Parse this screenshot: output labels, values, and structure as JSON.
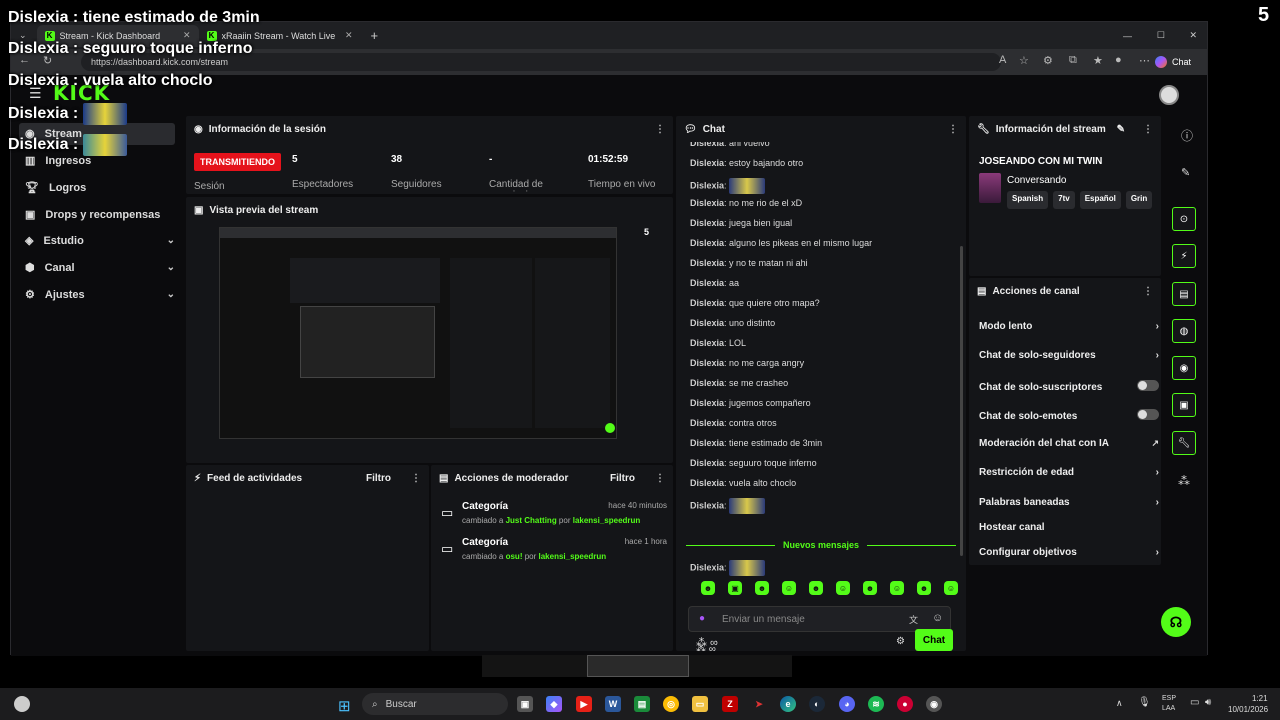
{
  "overlay": {
    "corner_number": "5",
    "lines": [
      {
        "name": "Dislexia",
        "sep": " : ",
        "text": "tiene estimado de 3min"
      },
      {
        "name": "Dislexia",
        "sep": " : ",
        "text": "seguuro toque inferno"
      },
      {
        "name": "Dislexia",
        "sep": " : ",
        "text": "vuela alto choclo"
      },
      {
        "name": "Dislexia",
        "sep": " : ",
        "text": ""
      },
      {
        "name": "Dislexia",
        "sep": " : ",
        "text": ""
      }
    ]
  },
  "browser": {
    "tabs": [
      {
        "label": "Stream - Kick Dashboard"
      },
      {
        "label": "xRaaiin Stream - Watch Live on Kic"
      }
    ],
    "url": "https://dashboard.kick.com/stream",
    "chat_button": "Chat"
  },
  "sidebar": {
    "logo": "KICK",
    "items": [
      {
        "label": "Stream"
      },
      {
        "label": "Ingresos"
      },
      {
        "label": "Logros"
      },
      {
        "label": "Drops y recompensas"
      },
      {
        "label": "Estudio"
      },
      {
        "label": "Canal"
      },
      {
        "label": "Ajustes"
      }
    ]
  },
  "session": {
    "title": "Información de la sesión",
    "badge": "TRANSMITIENDO",
    "badge_label": "Sesión",
    "stats": [
      {
        "value": "5",
        "label": "Espectadores"
      },
      {
        "value": "38",
        "label": "Seguidores"
      },
      {
        "value": "-",
        "label": "Cantidad de suscripciones"
      },
      {
        "value": "01:52:59",
        "label": "Tiempo en vivo"
      }
    ]
  },
  "preview": {
    "title": "Vista previa del stream",
    "overlay_number": "5"
  },
  "activity": {
    "title": "Feed de actividades",
    "filter": "Filtro"
  },
  "modactions": {
    "title": "Acciones de moderador",
    "filter": "Filtro",
    "items": [
      {
        "title": "Categoría",
        "time": "hace 40 minutos",
        "prefix": "cambiado a ",
        "category": "Just Chatting",
        "by": " por ",
        "user": "lakensi_speedrun"
      },
      {
        "title": "Categoría",
        "time": "hace 1 hora",
        "prefix": "cambiado a ",
        "category": "osu!",
        "by": " por ",
        "user": "lakensi_speedrun"
      }
    ]
  },
  "chat": {
    "title": "Chat",
    "messages": [
      {
        "user": "Dislexia",
        "text": "ahi vuelvo"
      },
      {
        "user": "Dislexia",
        "text": "estoy bajando otro"
      },
      {
        "user": "Dislexia",
        "text": ""
      },
      {
        "user": "Dislexia",
        "text": "no me rio de el xD"
      },
      {
        "user": "Dislexia",
        "text": "juega bien igual"
      },
      {
        "user": "Dislexia",
        "text": "alguno les pikeas en el mismo lugar"
      },
      {
        "user": "Dislexia",
        "text": "y no te matan ni ahi"
      },
      {
        "user": "Dislexia",
        "text": "aa"
      },
      {
        "user": "Dislexia",
        "text": "que quiere otro mapa?"
      },
      {
        "user": "Dislexia",
        "text": "uno distinto"
      },
      {
        "user": "Dislexia",
        "text": "LOL"
      },
      {
        "user": "Dislexia",
        "text": "no me carga angry"
      },
      {
        "user": "Dislexia",
        "text": "se me crasheo"
      },
      {
        "user": "Dislexia",
        "text": "jugemos compañero"
      },
      {
        "user": "Dislexia",
        "text": "contra otros"
      },
      {
        "user": "Dislexia",
        "text": "tiene estimado de 3min"
      },
      {
        "user": "Dislexia",
        "text": "seguuro toque inferno"
      },
      {
        "user": "Dislexia",
        "text": "vuela alto choclo"
      },
      {
        "user": "Dislexia",
        "text": ""
      }
    ],
    "new_messages": "Nuevos mensajes",
    "last_message": {
      "user": "Dislexia",
      "text": ""
    },
    "input_placeholder": "Enviar un mensaje",
    "send_button": "Chat"
  },
  "stream_info": {
    "title": "Información del stream",
    "stream_title": "JOSEANDO CON MI TWIN",
    "category": "Conversando",
    "tags": [
      "Spanish",
      "7tv",
      "Español",
      "Grin"
    ]
  },
  "channel_actions": {
    "title": "Acciones de canal",
    "items": [
      {
        "label": "Modo lento",
        "control": "chevron"
      },
      {
        "label": "Chat de solo-seguidores",
        "control": "chevron"
      },
      {
        "label": "Chat de solo-suscriptores",
        "control": "toggle"
      },
      {
        "label": "Chat de solo-emotes",
        "control": "toggle"
      },
      {
        "label": "Moderación del chat con IA",
        "control": "external"
      },
      {
        "label": "Restricción de edad",
        "control": "chevron"
      },
      {
        "label": "Palabras baneadas",
        "control": "chevron"
      },
      {
        "label": "Hostear canal",
        "control": "none"
      },
      {
        "label": "Configurar objetivos",
        "control": "chevron"
      }
    ]
  },
  "taskbar": {
    "search_placeholder": "Buscar",
    "lang": "ESP",
    "lang2": "LAA",
    "time": "1:21",
    "date": "10/01/2026"
  },
  "colors": {
    "accent": "#53fc18",
    "live_red": "#e5121b"
  }
}
